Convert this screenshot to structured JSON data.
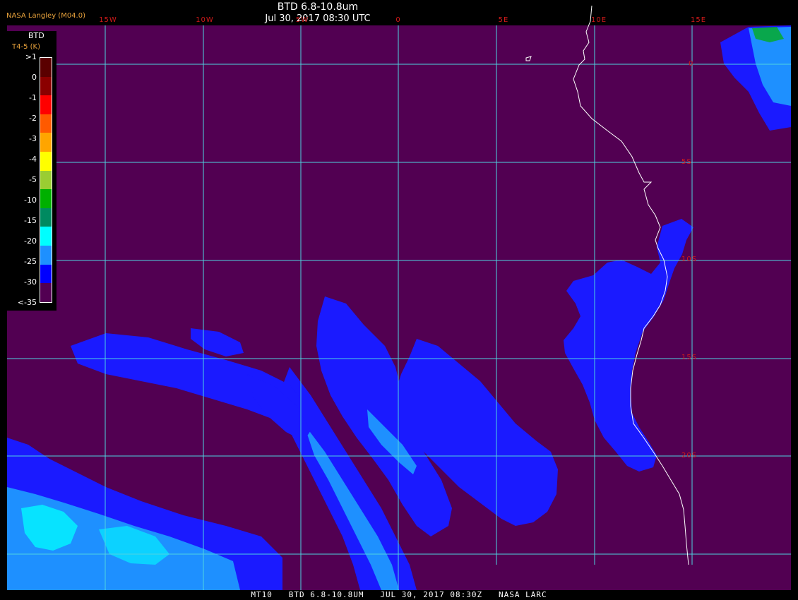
{
  "header": {
    "title": "BTD 6.8-10.8um",
    "timestamp": "Jul 30, 2017 08:30 UTC",
    "producer": "NASA Langley (M04.0)"
  },
  "footer": {
    "text": "MT10   BTD 6.8-10.8UM   JUL 30, 2017 08:30Z   NASA LARC"
  },
  "legend": {
    "title": "BTD",
    "subtitle": "T4-5 (K)",
    "labels": [
      ">1",
      "0",
      "-1",
      "-2",
      "-3",
      "-4",
      "-5",
      "-10",
      "-15",
      "-20",
      "-25",
      "-30",
      "<-35"
    ],
    "colors": [
      "#5a0000",
      "#8b0000",
      "#ff0000",
      "#ff5a00",
      "#ffa500",
      "#ffff00",
      "#9acd32",
      "#00b000",
      "#008a60",
      "#00ffff",
      "#1e90ff",
      "#0000ff",
      "#520052"
    ]
  },
  "grid": {
    "lon_labels": [
      "15W",
      "10W",
      "5W",
      "0",
      "5E",
      "10E",
      "15E"
    ],
    "lat_labels": [
      "0",
      "5S",
      "10S",
      "15S",
      "20S"
    ]
  },
  "colors": {
    "background": "#520052",
    "grid_line": "#4fd3e0",
    "coastline": "#ffffff",
    "cloud_main": "#1a1aff",
    "cloud_light": "#1e90ff",
    "cloud_cyan": "#00ffff",
    "grid_label": "#d11a1a"
  }
}
